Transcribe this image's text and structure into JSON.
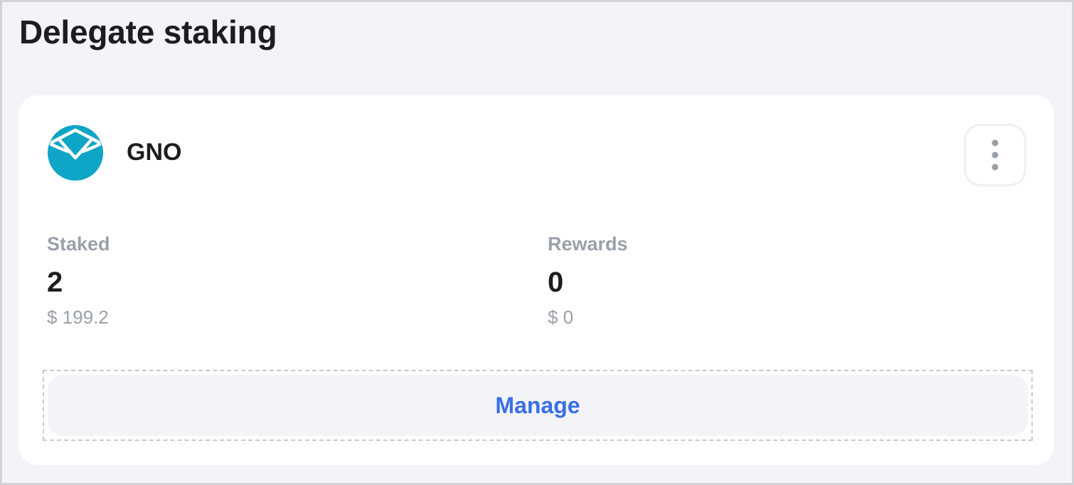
{
  "header": {
    "title": "Delegate staking"
  },
  "card": {
    "token": {
      "name": "GNO",
      "icon": "gnosis-owl-icon",
      "brand_color": "#0ea5c6"
    },
    "more_button": {
      "icon": "more-vertical-icon"
    },
    "staked": {
      "label": "Staked",
      "value": "2",
      "fiat": "$ 199.2"
    },
    "rewards": {
      "label": "Rewards",
      "value": "0",
      "fiat": "$ 0"
    },
    "manage_button": {
      "label": "Manage"
    }
  },
  "colors": {
    "accent": "#3a6ee8",
    "muted_text": "#9aa0aa",
    "primary_text": "#1c1d21",
    "page_background": "#f3f4f7",
    "card_background": "#ffffff"
  }
}
